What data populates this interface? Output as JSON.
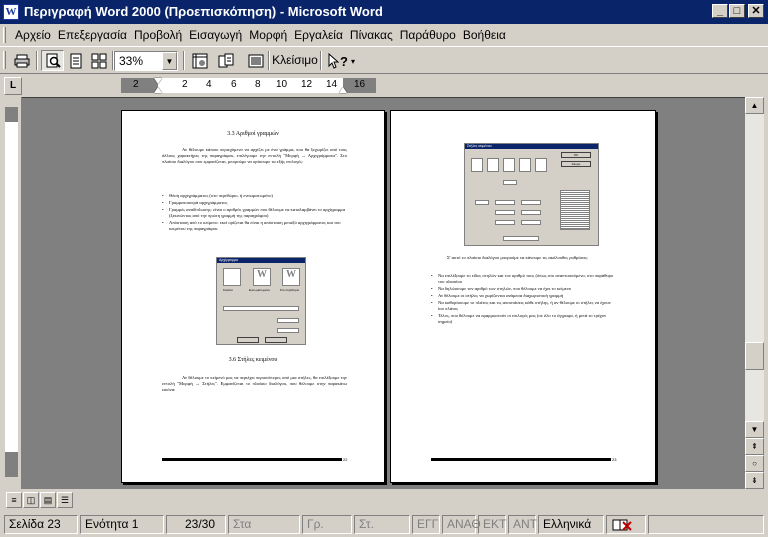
{
  "window": {
    "title": "Περιγραφή Word 2000 (Προεπισκόπηση) - Microsoft Word",
    "app_icon": "W"
  },
  "menu": [
    "Αρχείο",
    "Επεξεργασία",
    "Προβολή",
    "Εισαγωγή",
    "Μορφή",
    "Εργαλεία",
    "Πίνακας",
    "Παράθυρο",
    "Βοήθεια"
  ],
  "toolbar": {
    "zoom": "33%",
    "close_label": "Κλείσιμο",
    "help_icon": "?"
  },
  "ruler": {
    "numbers": [
      "2",
      "2",
      "4",
      "6",
      "8",
      "10",
      "12",
      "14",
      "16"
    ]
  },
  "page_left": {
    "heading1": "3.3 Αριθμοί γραμμών",
    "para1": "Αν θέλουμε κάποιο περιεχόμενο να αρχίζει με ένα γράμμα, που θα ξεχωρίζει από τους άλλους χαρακτήρες της παραγράφου, επιλέγουμε την εντολή \"Μορφή → Αρχιγράμματα\". Στο πλαίσιο διαλόγου που εμφανίζεται, μπορούμε να ορίσουμε τα εξής επιλογές:",
    "bullets": [
      "Θέση αρχιγράμματος (στο περιθώριο, ή ενσωματωμένο)",
      "Γραμματοσειρά αρχιγράμματος",
      "Γραμμές αναδίπλωσης: είναι ο αριθμός γραμμών που θέλουμε να καταλαμβάνει το αρχίγραμμα (ξεκινώντας από την πρώτη γραμμή της παραγράφου)",
      "Απόσταση από το κείμενο: εκεί ορίζεται θα είναι η απόσταση μεταξύ αρχιγράμματος και του κειμένου της παραγράφου."
    ],
    "dialog_title": "Αρχίγραμμα",
    "dialog_options": [
      "Κανένα",
      "Ενσωματωμένο",
      "Στο περιθώριο"
    ],
    "heading2": "3.6 Στήλες κειμένου",
    "para2": "Αν θέλουμε το κείμενό μας να περιέχει περισσότερες από μια στήλες, θα επιλέξουμε την εντολή \"Μορφή → Στήλες\". Εμφανίζεται το πλαίσιο διαλόγου, που θέλουμε στην παρακάτω εικόνα:",
    "page_no": "22"
  },
  "page_right": {
    "dialog_title": "Στήλες κειμένου",
    "ok": "OK",
    "cancel": "Άκυρο",
    "para1": "Σ' αυτό το πλαίσιο διαλόγου μπορούμε να κάνουμε τις ακόλουθες ρυθμίσεις:",
    "bullets": [
      "Να επιλέξουμε το είδος στηλών και τον αριθμό τους (όπως στο αναπτυσσόμενο, στο παράθυρο του πλαισίου",
      "Να δηλώσουμε τον αριθμό των στηλών, που θέλουμε να έχει το κείμενο",
      "Αν θέλουμε οι στήλες να χωρίζονται ανάμεσα διαχωριστική γραμμή",
      "Να καθορίσουμε το πλάτος και τις αποστάσεις κάθε στήλης, ή αν θέλουμε οι στήλες να έχουν ίσο πλάτος",
      "Τέλος, που θέλουμε να εφαρμοστούν οι επιλογές μας (σε όλο το έγγραφο, ή μετά το τρέχον σημείο)"
    ],
    "page_no": "23"
  },
  "status": {
    "page": "Σελίδα 23",
    "section": "Ενότητα 1",
    "pages": "23/30",
    "at": "Στα",
    "ln": "Γρ.",
    "col": "Στ.",
    "rec": "ΕΓΓ",
    "trk": "ΑΝΑΘ",
    "ext": "ΕΚΤ",
    "ovr": "ΑΝΤ",
    "language": "Ελληνικά"
  }
}
